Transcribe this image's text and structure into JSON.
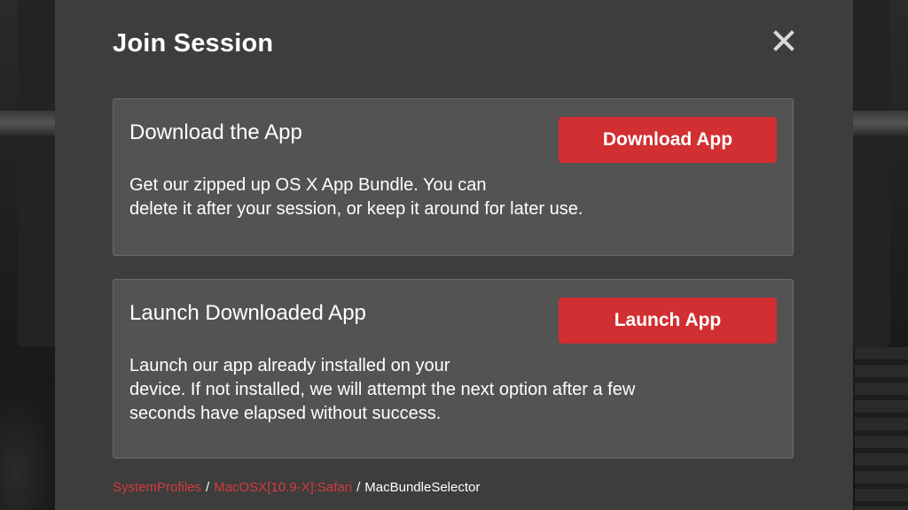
{
  "modal": {
    "title": "Join Session",
    "close_icon": "close-icon"
  },
  "cards": [
    {
      "title": "Download the App",
      "button_label": "Download App",
      "description_lines": [
        "Get our zipped up OS X App Bundle. You can",
        "delete it after your session, or keep it around for later use."
      ]
    },
    {
      "title": "Launch Downloaded App",
      "button_label": "Launch App",
      "description_lines": [
        "Launch our app already installed on your",
        "device. If not installed, we will attempt the next option after a few",
        "seconds have elapsed without success."
      ]
    }
  ],
  "breadcrumb": {
    "items": [
      "SystemProfiles",
      "MacOSX[10.9-X]:Safari",
      "MacBundleSelector"
    ],
    "separator": "/"
  },
  "colors": {
    "accent": "#d12f32",
    "link": "#d63a3d",
    "modal_bg": "#3d3d3d",
    "card_bg": "#535353"
  }
}
